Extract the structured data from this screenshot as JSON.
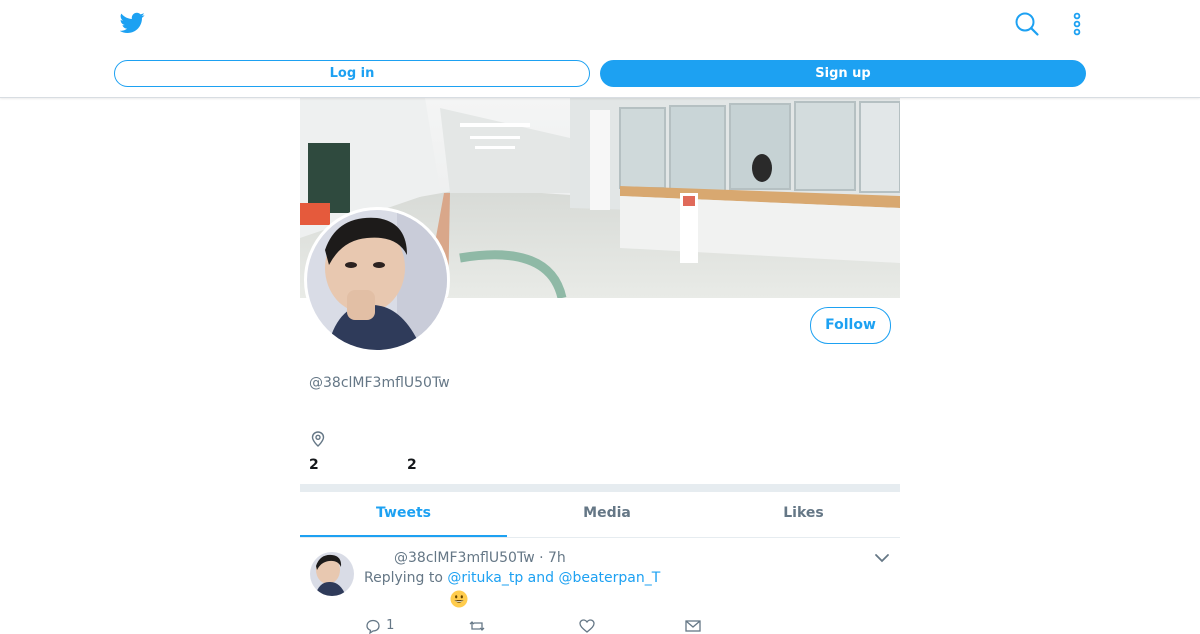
{
  "header": {
    "logo_icon": "twitter-bird-icon",
    "login_label": "Log in",
    "signup_label": "Sign up",
    "accent_color": "#1da1f2"
  },
  "profile": {
    "handle": "@38clMF3mflU50Tw",
    "follow_label": "Follow",
    "location_icon": "map-pin-icon",
    "following_count": "2",
    "followers_count": "2"
  },
  "tabs": [
    {
      "label": "Tweets",
      "active": true
    },
    {
      "label": "Media",
      "active": false
    },
    {
      "label": "Likes",
      "active": false
    }
  ],
  "tweet": {
    "handle": "@38clMF3mflU50Tw",
    "separator": "·",
    "time": "7h",
    "replying_prefix": "Replying to",
    "reply_user_1": "@rituka_tp",
    "reply_conj": "and",
    "reply_user_2": "@beaterpan_T",
    "emoji": "grinning-face-emoji",
    "reply_count": "1"
  }
}
